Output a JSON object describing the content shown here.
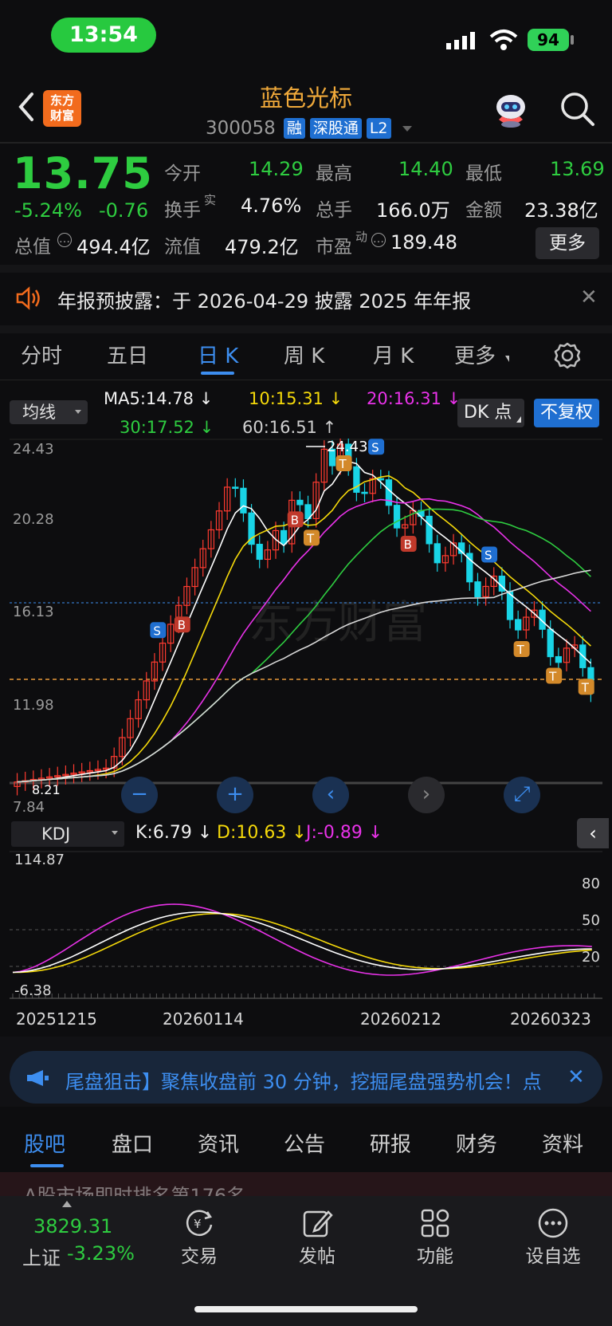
{
  "status_bar": {
    "time": "13:54",
    "battery": "94"
  },
  "header": {
    "logo_line1": "东方",
    "logo_line2": "财富",
    "stock_name": "蓝色光标",
    "stock_code": "300058",
    "tags": [
      "融",
      "深股通",
      "L2"
    ]
  },
  "quote": {
    "price": "13.75",
    "change_pct": "-5.24%",
    "change_amt": "-0.76",
    "open_label": "今开",
    "open": "14.29",
    "high_label": "最高",
    "high": "14.40",
    "low_label": "最低",
    "low": "13.69",
    "turnover_label": "换手",
    "turnover_sup": "实",
    "turnover": "4.76%",
    "volume_label": "总手",
    "volume": "166.0万",
    "amount_label": "金额",
    "amount": "23.38亿",
    "mktcap_label": "总值",
    "mktcap": "494.4亿",
    "float_label": "流值",
    "float_cap": "479.2亿",
    "pe_label": "市盈",
    "pe_sup": "动",
    "pe": "189.48",
    "more_label": "更多"
  },
  "notice": {
    "text": "年报预披露：于 2026-04-29 披露 2025 年年报"
  },
  "kline_tabs": [
    "分时",
    "五日",
    "日 K",
    "周 K",
    "月 K",
    "更多"
  ],
  "ma_legend": {
    "selector": "均线",
    "ma5": "MA5:14.78 ↓",
    "ma10": "10:15.31 ↓",
    "ma20": "20:16.31 ↓",
    "ma30": "30:17.52 ↓",
    "ma60": "60:16.51 ↑",
    "dk_label": "DK 点",
    "fuquan_label": "不复权"
  },
  "kchart": {
    "y_labels": [
      "24.43",
      "20.28",
      "16.13",
      "11.98",
      "7.84"
    ],
    "max_marker": "24.43",
    "min_marker": "8.21",
    "colors": {
      "up": "#ff3b30",
      "down": "#19d4e6",
      "ma5": "#ffffff",
      "ma10": "#f5d90a",
      "ma20": "#e832e8",
      "ma30": "#2ecc40",
      "ma60": "#d8d8d8"
    }
  },
  "kdj": {
    "selector": "KDJ",
    "k": "K:6.79 ↓",
    "d": "D:10.63 ↓",
    "j": "J:-0.89 ↓",
    "y_top": "114.87",
    "y_bottom": "-6.38",
    "levels": [
      "80",
      "50",
      "20"
    ],
    "dates": [
      "20251215",
      "20260114",
      "20260212",
      "20260323"
    ]
  },
  "banner": {
    "text": "尾盘狙击】聚焦收盘前 30 分钟，挖掘尾盘强势机会！点"
  },
  "bottom_tabs": [
    "股吧",
    "盘口",
    "资讯",
    "公告",
    "研报",
    "财务",
    "资料"
  ],
  "peek_text": "A股市场即时排名第176名",
  "bottom_nav": {
    "index_value": "3829.31",
    "index_name": "上证",
    "index_pct": "-3.23%",
    "items": [
      "交易",
      "发帖",
      "功能",
      "设自选"
    ]
  }
}
